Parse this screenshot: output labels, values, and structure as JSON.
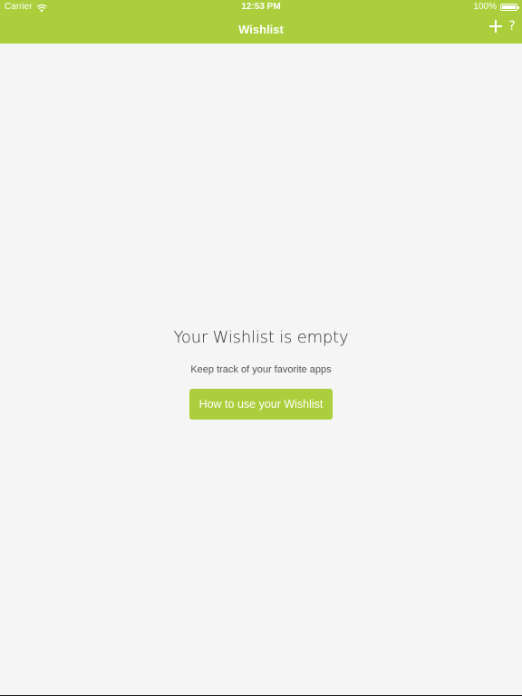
{
  "status_bar": {
    "carrier": "Carrier",
    "time": "12:53 PM",
    "battery": "100%",
    "battery_level": 1.0
  },
  "nav_bar": {
    "title": "Wishlist",
    "add_icon": "plus-icon",
    "help_label": "?"
  },
  "empty_state": {
    "title": "Your Wishlist is empty",
    "subtitle": "Keep track of your favorite apps",
    "button_label": "How to use your Wishlist"
  },
  "colors": {
    "accent": "#abcf3c",
    "background": "#f5f5f5",
    "title_text": "#333333",
    "subtitle_text": "#555555"
  }
}
